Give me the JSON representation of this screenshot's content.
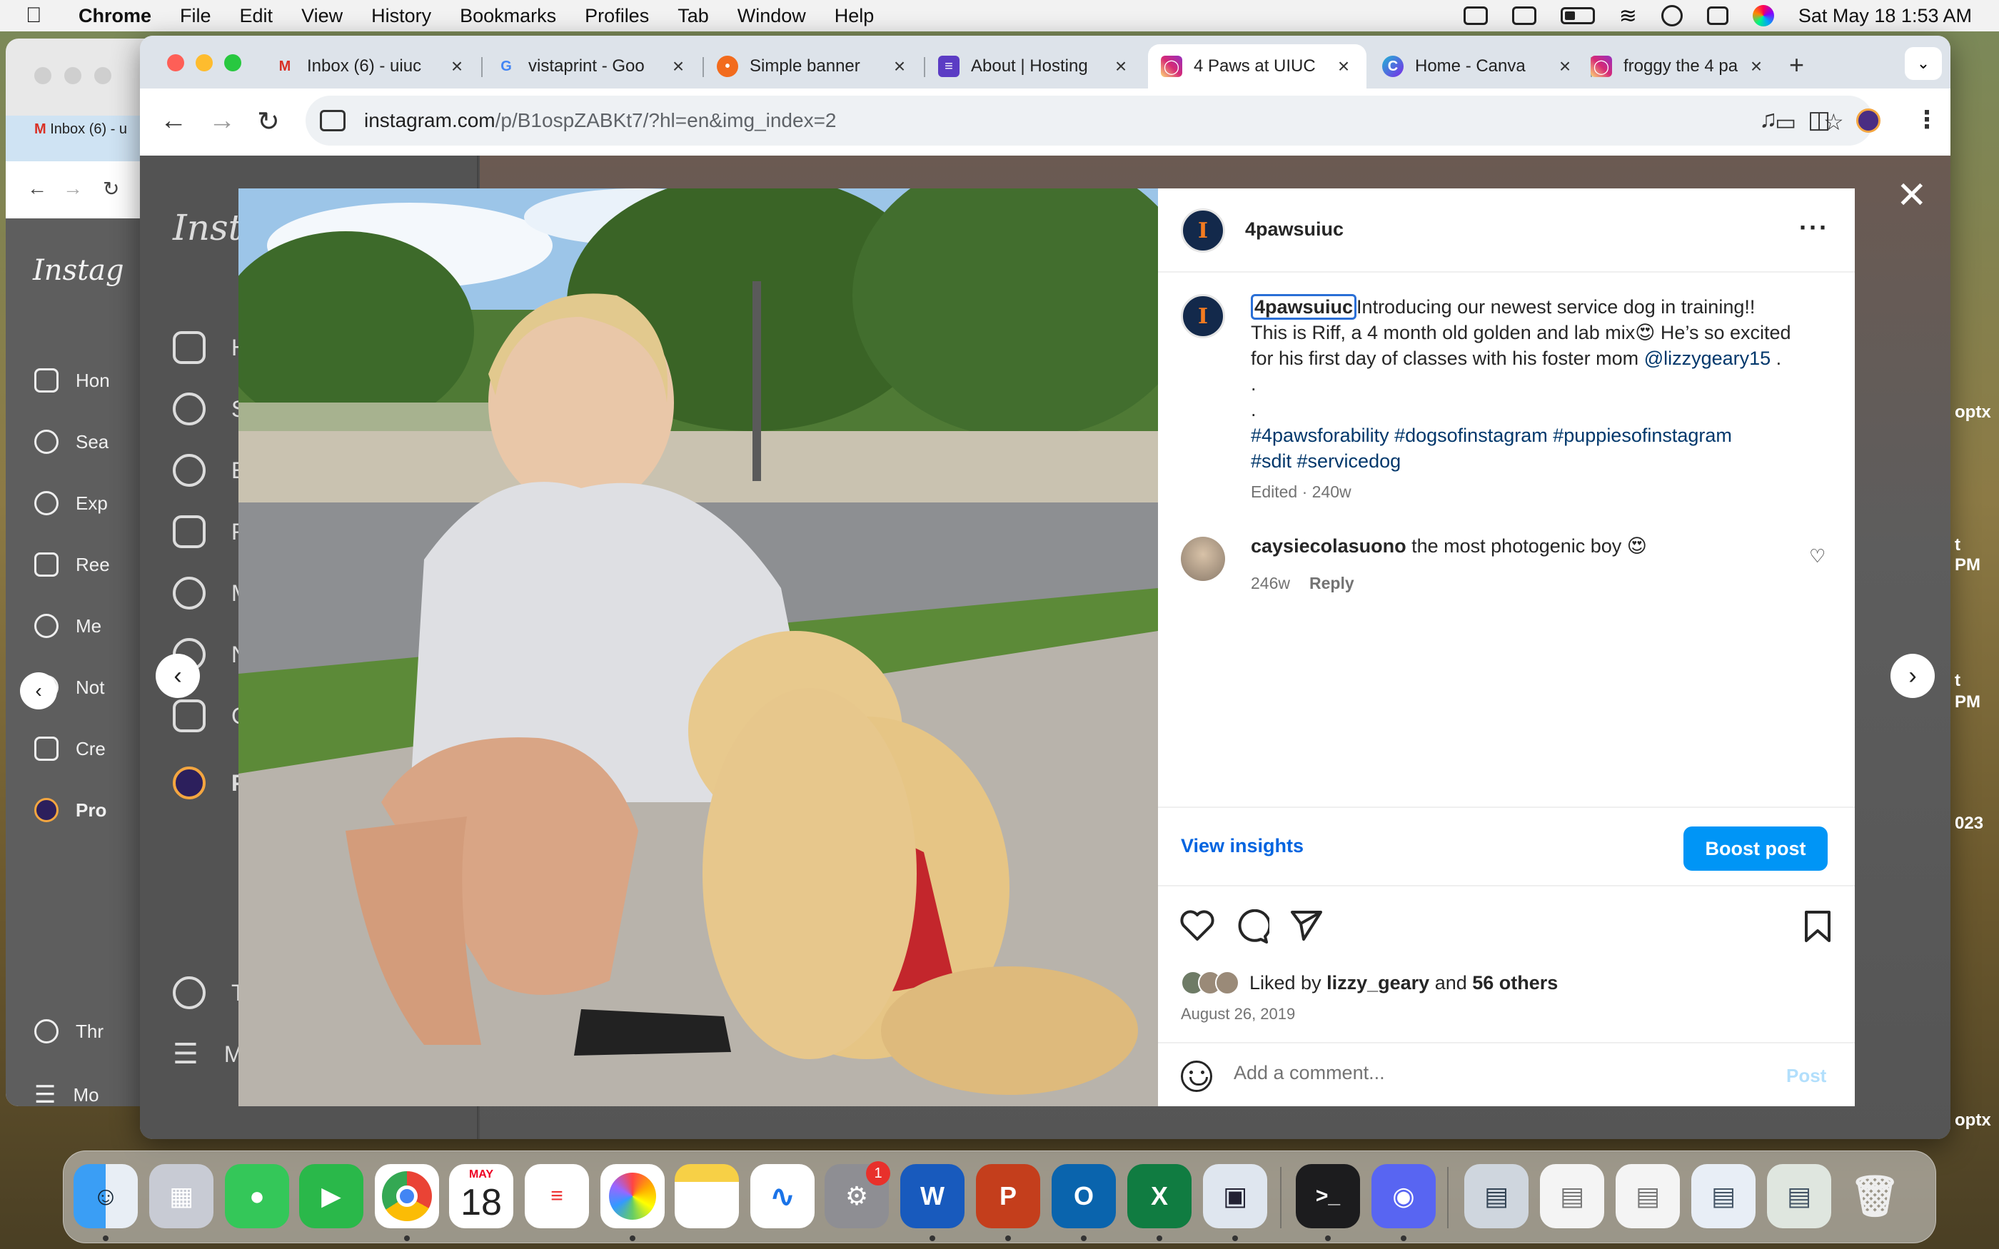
{
  "menubar": {
    "app_name": "Chrome",
    "items": [
      "File",
      "Edit",
      "View",
      "History",
      "Bookmarks",
      "Profiles",
      "Tab",
      "Window",
      "Help"
    ],
    "clock": "Sat May 18  1:53 AM"
  },
  "bg_window": {
    "tab_label": "Inbox (6) - u",
    "sidebar_logo": "Instag",
    "sidebar_items": [
      "Hon",
      "Sea",
      "Exp",
      "Ree",
      "Me",
      "Not",
      "Cre",
      "Pro",
      "Thr",
      "Mo"
    ]
  },
  "tabs": [
    {
      "label": "Inbox (6) - uiuc",
      "icon": "gmail-icon",
      "color": "#ffffff"
    },
    {
      "label": "vistaprint - Goo",
      "icon": "google-icon",
      "color": "#ffffff"
    },
    {
      "label": "Simple banner",
      "icon": "banner-icon",
      "color": "#f26b1d"
    },
    {
      "label": "About | Hosting",
      "icon": "hosting-icon",
      "color": "#5b3cc4"
    },
    {
      "label": "4 Paws at UIUC",
      "icon": "instagram-icon",
      "color": "#d62976"
    },
    {
      "label": "Home - Canva",
      "icon": "canva-icon",
      "color": "#1fb6d4"
    },
    {
      "label": "froggy the 4 pa",
      "icon": "instagram-icon",
      "color": "#d62976"
    }
  ],
  "omnibox": {
    "url_host": "instagram.com",
    "url_path": "/p/B1ospZABKt7/?hl=en&img_index=2"
  },
  "ig_sidebar": {
    "logo": "Insta",
    "items": [
      "H",
      "S",
      "E",
      "R",
      "M",
      "N",
      "C",
      "P",
      "T",
      "M"
    ]
  },
  "post": {
    "username": "4pawsuiuc",
    "caption_username": "4pawsuiuc",
    "caption_line1": "Introducing our newest service dog in training!!",
    "caption_line2": "This is Riff, a 4 month old golden and lab mix😍 He’s so excited",
    "caption_line3": "for his first day of classes with his foster mom",
    "caption_mention": "@lizzygeary15",
    "caption_end": " .",
    "dot1": ".",
    "dot2": ".",
    "hashtags_line1": "#4pawsforability #dogsofinstagram #puppiesofinstagram",
    "hashtags_line2": "#sdit #servicedog",
    "edited": "Edited · 240w",
    "comment_user": "caysiecolasuono",
    "comment_text": " the most photogenic boy 😍",
    "comment_age": "246w",
    "reply": "Reply",
    "view_insights": "View insights",
    "boost": "Boost post",
    "liked_by_prefix": "Liked by ",
    "liked_by_user": "lizzy_geary",
    "liked_by_and": " and ",
    "liked_by_others": "56 others",
    "date": "August 26, 2019",
    "comment_placeholder": "Add a comment...",
    "post_label": "Post"
  },
  "dock": {
    "calendar_month": "MAY",
    "calendar_day": "18",
    "settings_badge": "1"
  },
  "right_edge": [
    "optx",
    "t",
    "PM",
    "t",
    "PM",
    "023",
    "optx"
  ]
}
